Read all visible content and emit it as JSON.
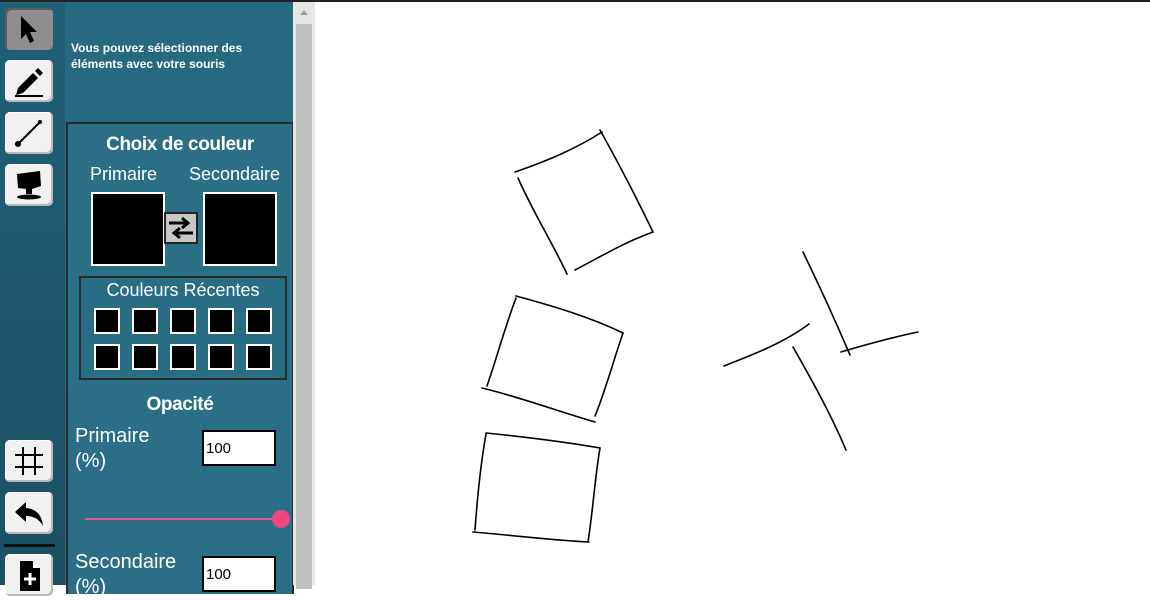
{
  "toolbar": {
    "tools": [
      {
        "name": "select-tool",
        "icon": "cursor-arrow-icon",
        "active": true
      },
      {
        "name": "pencil-tool",
        "icon": "pencil-icon",
        "active": false
      },
      {
        "name": "line-tool",
        "icon": "line-icon",
        "active": false
      },
      {
        "name": "fill-tool",
        "icon": "paint-bucket-icon",
        "active": false
      }
    ],
    "bottom_tools": [
      {
        "name": "grid-tool",
        "icon": "grid-icon"
      },
      {
        "name": "undo-tool",
        "icon": "undo-icon"
      },
      {
        "name": "new-file-tool",
        "icon": "new-file-icon"
      }
    ]
  },
  "panel": {
    "info_text": "Vous pouvez sélectionner des éléments avec votre souris",
    "color_title": "Choix de couleur",
    "primary_label": "Primaire",
    "secondary_label": "Secondaire",
    "primary_color": "#000000",
    "secondary_color": "#000000",
    "recent_title": "Couleurs Récentes",
    "recent_colors": [
      "#000000",
      "#000000",
      "#000000",
      "#000000",
      "#000000",
      "#000000",
      "#000000",
      "#000000",
      "#000000",
      "#000000"
    ],
    "opacity_title": "Opacité",
    "opacity_primary_label": "Primaire (%)",
    "opacity_primary_value": "100",
    "opacity_primary_level": 1.0,
    "opacity_secondary_label": "Secondaire (%)",
    "opacity_secondary_value": "100",
    "accent_color": "#f0457e"
  },
  "canvas": {
    "background": "#ffffff",
    "stroke_color": "#000000"
  }
}
